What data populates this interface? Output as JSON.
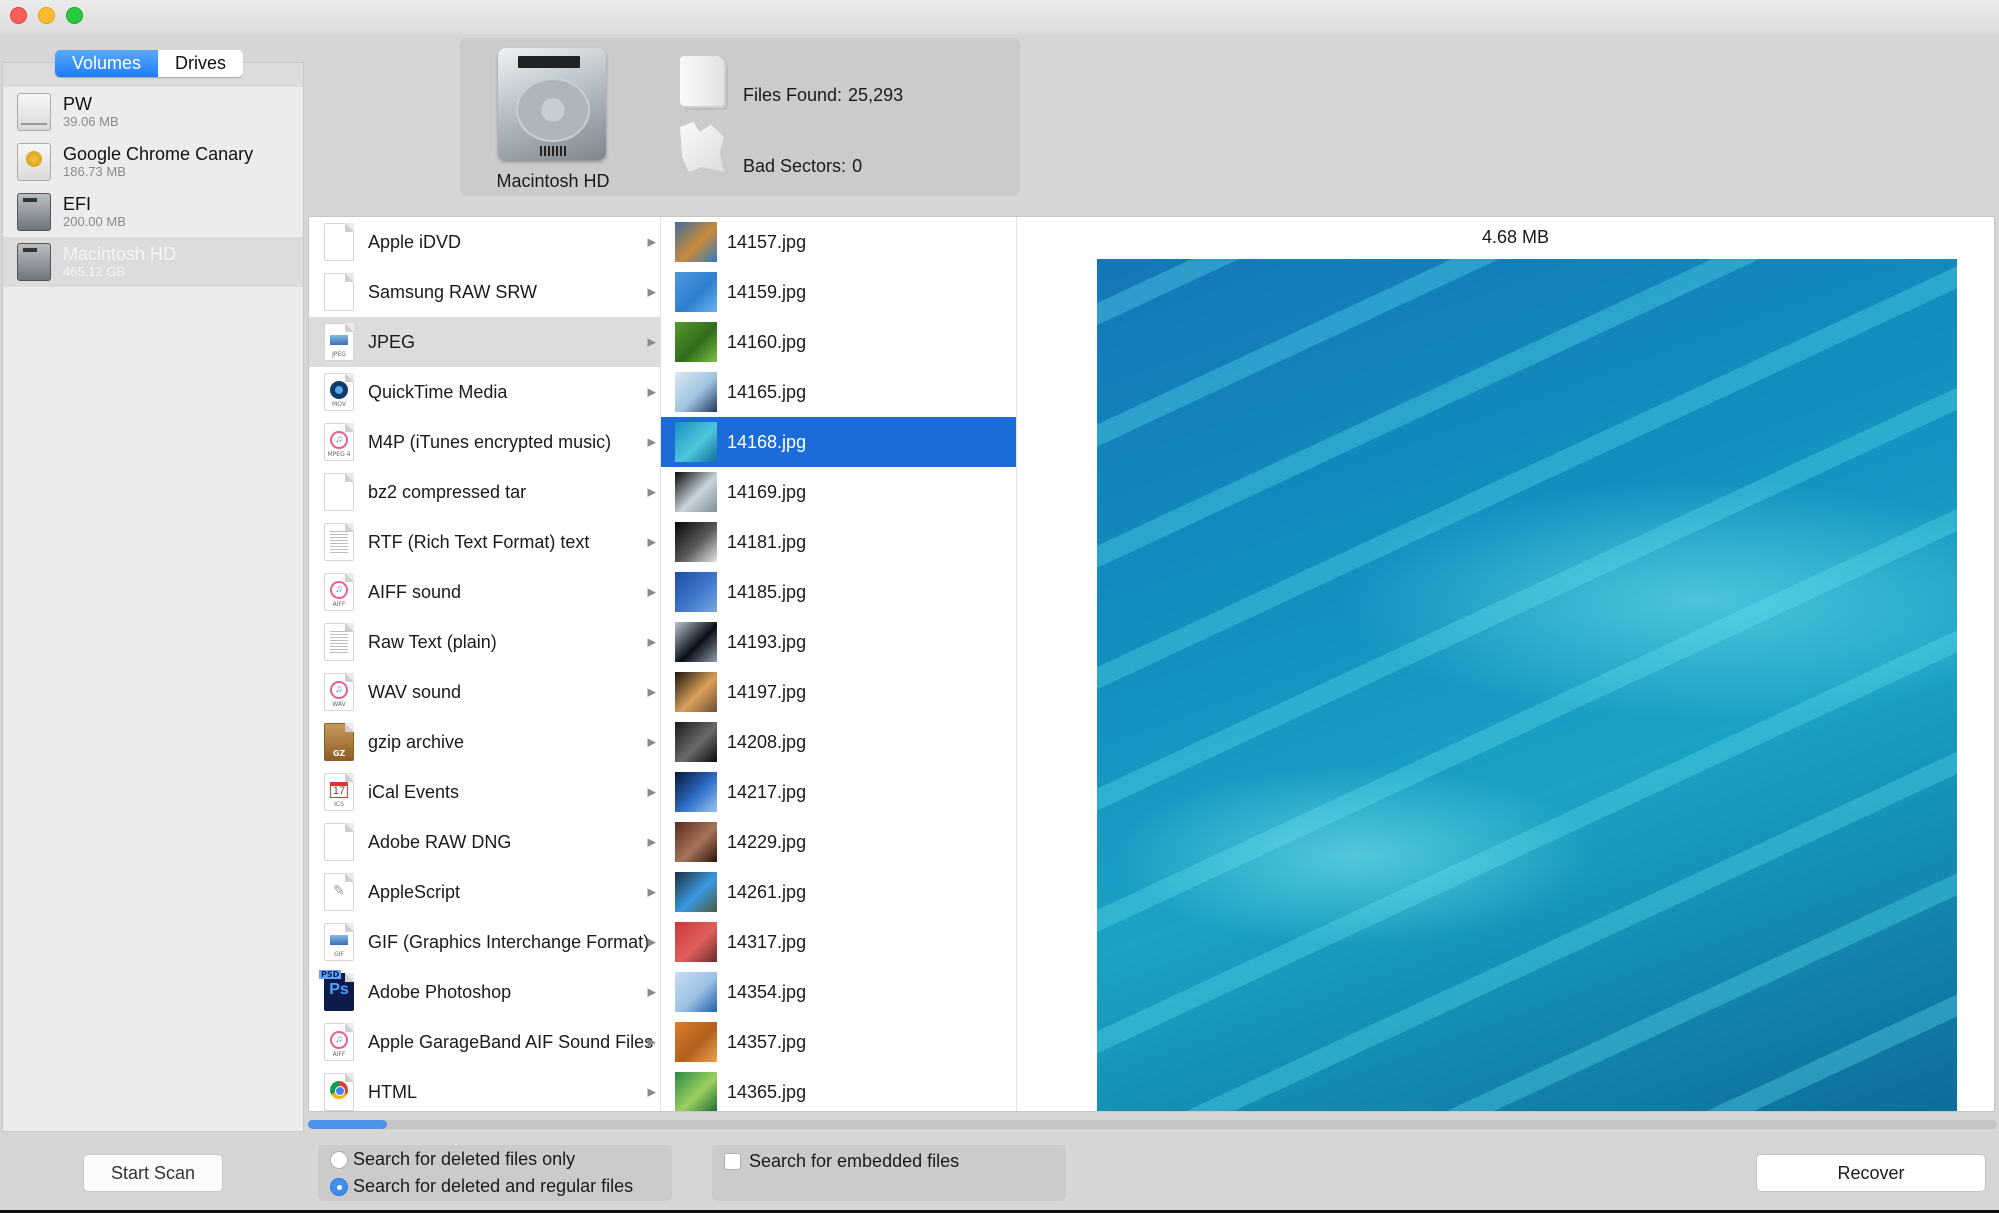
{
  "window": {
    "traffic_lights": [
      "close",
      "minimize",
      "maximize"
    ]
  },
  "sidebar": {
    "segments": [
      {
        "label": "Volumes",
        "active": true
      },
      {
        "label": "Drives",
        "active": false
      }
    ],
    "volumes": [
      {
        "name": "PW",
        "size": "39.06 MB",
        "icon": "external-drive-icon",
        "selected": false
      },
      {
        "name": "Google Chrome Canary",
        "size": "186.73 MB",
        "icon": "canary-disk-icon",
        "selected": false
      },
      {
        "name": "EFI",
        "size": "200.00 MB",
        "icon": "hard-drive-icon",
        "selected": false
      },
      {
        "name": "Macintosh HD",
        "size": "465.12 GB",
        "icon": "hard-drive-icon",
        "selected": true
      }
    ],
    "start_scan_label": "Start Scan"
  },
  "summary": {
    "drive_name": "Macintosh HD",
    "files_found_label": "Files Found:",
    "files_found_value": "25,293",
    "bad_sectors_label": "Bad Sectors:",
    "bad_sectors_value": "0"
  },
  "file_types": [
    {
      "label": "Apple iDVD",
      "icon": "blank",
      "tag": "",
      "selected": false
    },
    {
      "label": "Samsung RAW SRW",
      "icon": "blank",
      "tag": "",
      "selected": false
    },
    {
      "label": "JPEG",
      "icon": "img",
      "tag": "JPEG",
      "selected": true
    },
    {
      "label": "QuickTime Media",
      "icon": "qt",
      "tag": "MOV",
      "selected": false
    },
    {
      "label": "M4P (iTunes encrypted music)",
      "icon": "music",
      "tag": "MPEG 4",
      "selected": false
    },
    {
      "label": "bz2 compressed tar",
      "icon": "blank",
      "tag": "",
      "selected": false
    },
    {
      "label": "RTF (Rich Text Format) text",
      "icon": "text",
      "tag": "",
      "selected": false
    },
    {
      "label": "AIFF sound",
      "icon": "music",
      "tag": "AIFF",
      "selected": false
    },
    {
      "label": "Raw Text (plain)",
      "icon": "text",
      "tag": "",
      "selected": false
    },
    {
      "label": "WAV sound",
      "icon": "music",
      "tag": "WAV",
      "selected": false
    },
    {
      "label": "gzip archive",
      "icon": "gz",
      "tag": "GZ",
      "selected": false
    },
    {
      "label": "iCal Events",
      "icon": "cal",
      "tag": "ICS",
      "selected": false
    },
    {
      "label": "Adobe RAW DNG",
      "icon": "blank",
      "tag": "",
      "selected": false
    },
    {
      "label": "AppleScript",
      "icon": "script",
      "tag": "",
      "selected": false
    },
    {
      "label": "GIF (Graphics Interchange Format)",
      "icon": "img",
      "tag": "GIF",
      "selected": false
    },
    {
      "label": "Adobe Photoshop",
      "icon": "ps",
      "tag": "PSD",
      "selected": false
    },
    {
      "label": "Apple GarageBand AIF Sound Files",
      "icon": "music",
      "tag": "AIFF",
      "selected": false
    },
    {
      "label": "HTML",
      "icon": "chrome",
      "tag": "",
      "selected": false
    }
  ],
  "files": [
    {
      "name": "14157.jpg",
      "thumb": [
        "#3f6e9a",
        "#c98a3a",
        "#2d7bc4"
      ],
      "selected": false
    },
    {
      "name": "14159.jpg",
      "thumb": [
        "#4f9ae0",
        "#2f7fd0",
        "#6bb3ee"
      ],
      "selected": false
    },
    {
      "name": "14160.jpg",
      "thumb": [
        "#5a9a2c",
        "#2f6b1c",
        "#7cc043"
      ],
      "selected": false
    },
    {
      "name": "14165.jpg",
      "thumb": [
        "#dbe8f3",
        "#9ec3e0",
        "#1f3a5a"
      ],
      "selected": false
    },
    {
      "name": "14168.jpg",
      "thumb": [
        "#1c8fc0",
        "#4fc6dc",
        "#0f6f9f"
      ],
      "selected": true
    },
    {
      "name": "14169.jpg",
      "thumb": [
        "#0a0a0a",
        "#c8d4dc",
        "#7f8e99"
      ],
      "selected": false
    },
    {
      "name": "14181.jpg",
      "thumb": [
        "#050505",
        "#5a5a5a",
        "#e6e6e6"
      ],
      "selected": false
    },
    {
      "name": "14185.jpg",
      "thumb": [
        "#1d4fa0",
        "#3f78cc",
        "#7aa7e0"
      ],
      "selected": false
    },
    {
      "name": "14193.jpg",
      "thumb": [
        "#b8c4d0",
        "#0a0d18",
        "#8e9cab"
      ],
      "selected": false
    },
    {
      "name": "14197.jpg",
      "thumb": [
        "#1b1510",
        "#d9a05a",
        "#6b5030"
      ],
      "selected": false
    },
    {
      "name": "14208.jpg",
      "thumb": [
        "#1a1a1a",
        "#6a6a6a",
        "#0a0a0a"
      ],
      "selected": false
    },
    {
      "name": "14217.jpg",
      "thumb": [
        "#06163a",
        "#2f6fc8",
        "#9cc6ef"
      ],
      "selected": false
    },
    {
      "name": "14229.jpg",
      "thumb": [
        "#5a2d1a",
        "#a8745a",
        "#2b150c"
      ],
      "selected": false
    },
    {
      "name": "14261.jpg",
      "thumb": [
        "#1a3040",
        "#3a9ae0",
        "#4a5a40"
      ],
      "selected": false
    },
    {
      "name": "14317.jpg",
      "thumb": [
        "#c8383a",
        "#e0605a",
        "#6a2a30"
      ],
      "selected": false
    },
    {
      "name": "14354.jpg",
      "thumb": [
        "#c6dff2",
        "#9ac0e4",
        "#1f5fa8"
      ],
      "selected": false
    },
    {
      "name": "14357.jpg",
      "thumb": [
        "#e07c2a",
        "#b0601c",
        "#f0a050"
      ],
      "selected": false
    },
    {
      "name": "14365.jpg",
      "thumb": [
        "#2a8a44",
        "#9ed060",
        "#1a6a34"
      ],
      "selected": false
    }
  ],
  "preview": {
    "size": "4.68 MB",
    "image_desc": "aerial view of turquoise sand banks"
  },
  "scroll": {
    "horizontal_position_fraction": 0.047
  },
  "options": {
    "radio": [
      {
        "label": "Search for deleted files only",
        "checked": false
      },
      {
        "label": "Search for deleted and regular files",
        "checked": true
      }
    ],
    "embedded_label": "Search for embedded files",
    "embedded_checked": false
  },
  "recover_label": "Recover",
  "colors": {
    "accent": "#1b6bd9",
    "segment_active": "#1d7ef5",
    "scroll_thumb": "#4c93ec"
  }
}
